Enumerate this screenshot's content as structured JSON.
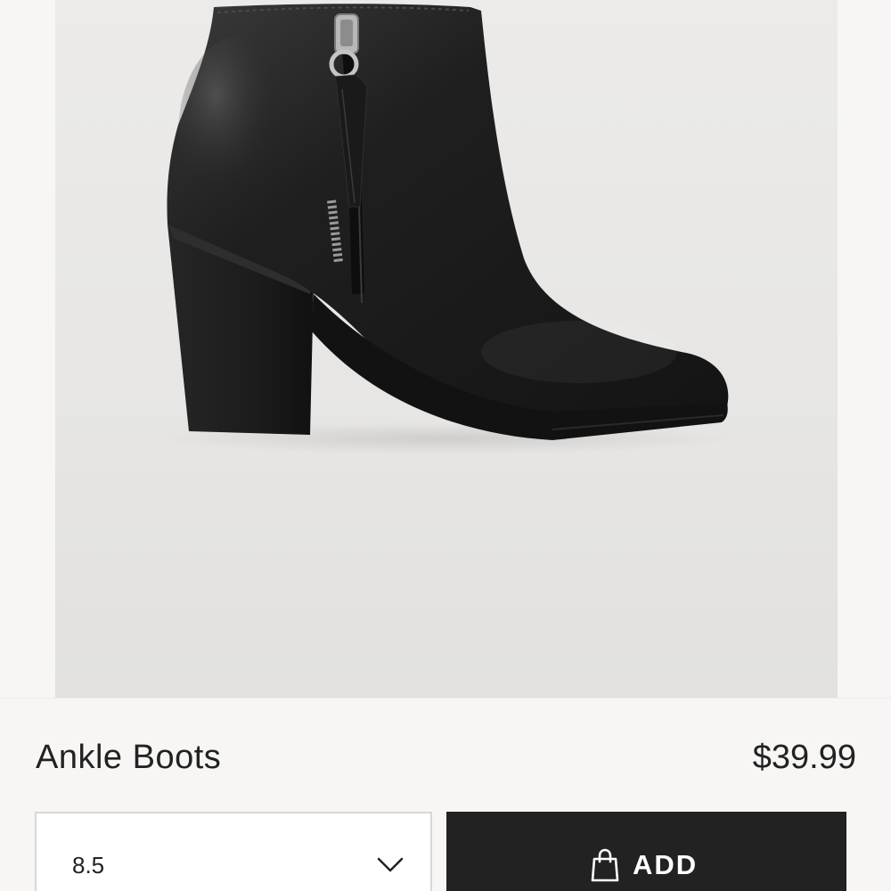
{
  "product": {
    "name": "Ankle Boots",
    "price": "$39.99",
    "image_alt": "Black leather ankle boot with side zipper and block heel"
  },
  "size_selector": {
    "selected_value": "8.5",
    "icon": "chevron-down-icon"
  },
  "add_button": {
    "label": "ADD",
    "icon": "shopping-bag-icon"
  },
  "colors": {
    "background": "#f7f6f4",
    "text": "#222222",
    "button_bg": "#222222",
    "button_text": "#ffffff",
    "select_border": "#d8d7d5"
  }
}
